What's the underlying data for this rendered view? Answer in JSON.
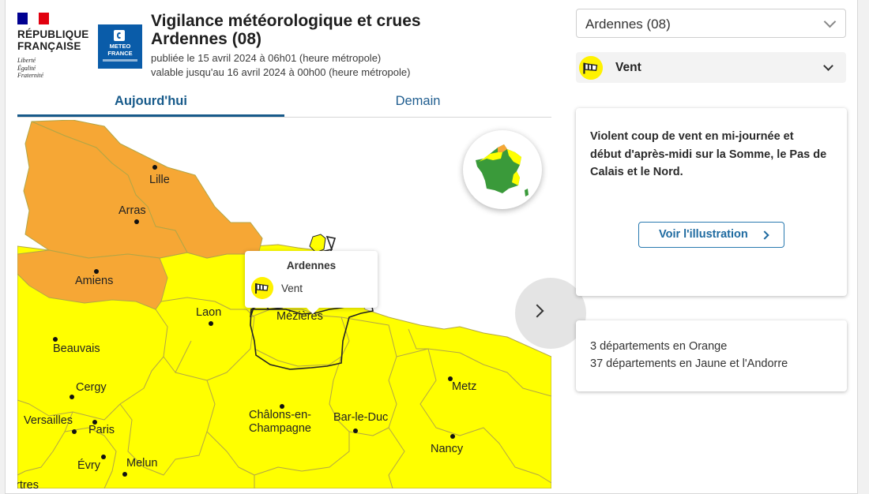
{
  "header": {
    "rf_name": "RÉPUBLIQUE\nFRANÇAISE",
    "rf_motto": "Liberté\nÉgalité\nFraternité",
    "mf_name": "METEO\nFRANCE",
    "title": "Vigilance météorologique et crues",
    "subtitle": "Ardennes  (08)",
    "published": "publiée le 15 avril 2024 à 06h01 (heure métropole)",
    "valid": "valable jusqu'au 16 avril 2024 à 00h00 (heure métropole)"
  },
  "tabs": [
    {
      "label": "Aujourd'hui",
      "active": true
    },
    {
      "label": "Demain",
      "active": false
    }
  ],
  "map": {
    "colors": {
      "orange": "#f6a735",
      "yellow": "#ffff00",
      "border": "#b5a84a"
    },
    "cities": [
      "Lille",
      "Arras",
      "Amiens",
      "Laon",
      "Mézières",
      "Beauvais",
      "Cergy",
      "Versailles",
      "Paris",
      "Évry",
      "Melun",
      "Châlons-en-\nChampagne",
      "Bar-le-Duc",
      "Metz",
      "Nancy",
      "rtres"
    ],
    "tooltip": {
      "title": "Ardennes",
      "phenomenon": "Vent"
    }
  },
  "sidebar": {
    "department_select": "Ardennes  (08)",
    "phenomenon": "Vent",
    "description": "Violent coup de vent en mi-journée et début d'après-midi sur la Somme, le Pas de Calais et le Nord.",
    "illustration_button": "Voir l'illustration",
    "stats": [
      "3 départements en Orange",
      "37 départements en Jaune et l'Andorre"
    ]
  }
}
